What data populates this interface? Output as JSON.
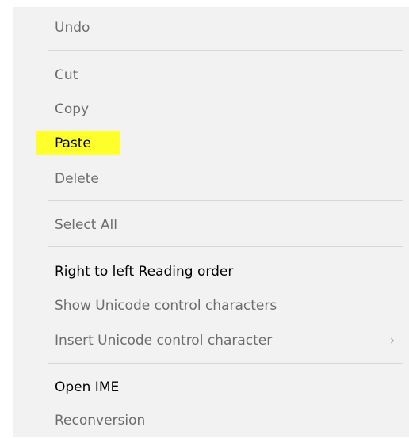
{
  "menu": {
    "items": [
      {
        "label": "Undo"
      },
      {
        "label": "Cut"
      },
      {
        "label": "Copy"
      },
      {
        "label": "Paste"
      },
      {
        "label": "Delete"
      },
      {
        "label": "Select All"
      },
      {
        "label": "Right to left Reading order"
      },
      {
        "label": "Show Unicode control characters"
      },
      {
        "label": "Insert Unicode control character",
        "submenu_icon": "chevron-right-icon"
      },
      {
        "label": "Open IME"
      },
      {
        "label": "Reconversion"
      }
    ],
    "chevron_glyph": "›",
    "highlight_color": "#ffff2c"
  }
}
